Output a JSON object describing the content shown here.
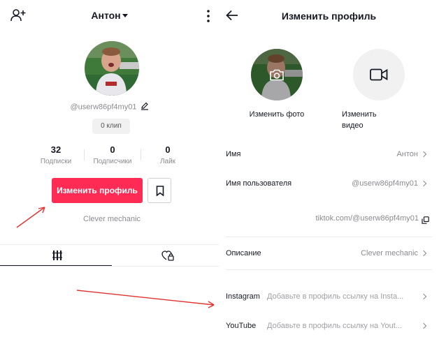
{
  "left": {
    "title": "Антон",
    "username": "@userw86pf4my01",
    "clips": "0 клип",
    "stats": [
      {
        "value": "32",
        "label": "Подписки"
      },
      {
        "value": "0",
        "label": "Подписчики"
      },
      {
        "value": "0",
        "label": "Лайк"
      }
    ],
    "edit_button": "Изменить профиль",
    "bio": "Clever mechanic",
    "icons": {
      "add_user": "add-user-icon",
      "more": "more-vertical-icon",
      "edit": "pencil-icon",
      "bookmark": "bookmark-icon",
      "grid": "grid-icon",
      "liked": "heart-lock-icon"
    }
  },
  "right": {
    "title": "Изменить профиль",
    "change_photo": "Изменить фото",
    "change_video_line1": "Изменить",
    "change_video_line2": "видео",
    "rows": [
      {
        "label": "Имя",
        "value": "Антон"
      },
      {
        "label": "Имя пользователя",
        "value": "@userw86pf4my01"
      }
    ],
    "link": "tiktok.com/@userw86pf4my01",
    "description": {
      "label": "Описание",
      "value": "Clever mechanic"
    },
    "socials": [
      {
        "label": "Instagram",
        "placeholder": "Добавьте в профиль ссылку на Insta..."
      },
      {
        "label": "YouTube",
        "placeholder": "Добавьте в профиль ссылку на Yout..."
      }
    ],
    "icons": {
      "back": "back-arrow-icon",
      "camera": "camera-icon",
      "video": "video-camera-icon",
      "copy": "copy-icon",
      "chevron": "chevron-right-icon"
    }
  },
  "annotations": {
    "arrow_color": "#e0322f"
  },
  "colors": {
    "accent": "#fe2c55",
    "text": "#161823",
    "muted": "#8a8b91"
  }
}
